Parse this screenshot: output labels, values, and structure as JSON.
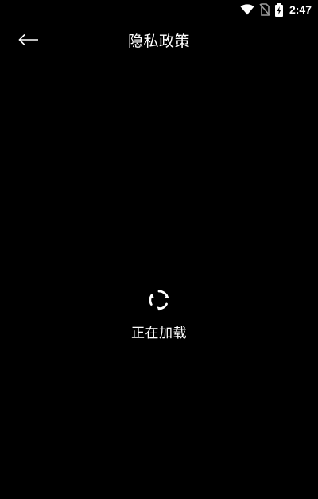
{
  "status_bar": {
    "time": "2:47",
    "icons": [
      "wifi-icon",
      "no-sim-icon",
      "battery-charging-icon"
    ]
  },
  "app_bar": {
    "back_icon": "arrow-left-icon",
    "title": "隐私政策"
  },
  "loading": {
    "icon": "loading-spinner-icon",
    "text": "正在加载"
  },
  "colors": {
    "background": "#000000",
    "foreground": "#ffffff"
  }
}
